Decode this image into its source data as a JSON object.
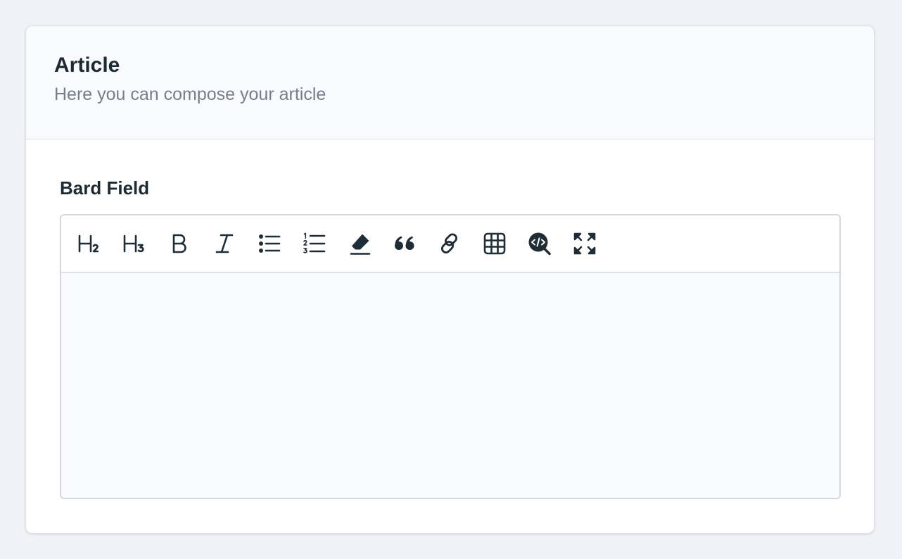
{
  "card": {
    "title": "Article",
    "subtitle": "Here you can compose your article"
  },
  "field": {
    "label": "Bard Field",
    "content": ""
  },
  "toolbar": {
    "buttons": [
      {
        "name": "heading-2",
        "icon": "h2-icon"
      },
      {
        "name": "heading-3",
        "icon": "h3-icon"
      },
      {
        "name": "bold",
        "icon": "bold-icon"
      },
      {
        "name": "italic",
        "icon": "italic-icon"
      },
      {
        "name": "bullet-list",
        "icon": "unordered-list-icon"
      },
      {
        "name": "ordered-list",
        "icon": "ordered-list-icon"
      },
      {
        "name": "clear-formatting",
        "icon": "eraser-icon"
      },
      {
        "name": "blockquote",
        "icon": "quote-icon"
      },
      {
        "name": "link",
        "icon": "link-icon"
      },
      {
        "name": "table",
        "icon": "table-icon"
      },
      {
        "name": "view-source",
        "icon": "code-search-icon"
      },
      {
        "name": "fullscreen",
        "icon": "expand-icon"
      }
    ]
  },
  "colors": {
    "page_background": "#eff2f6",
    "card_background": "#ffffff",
    "header_background": "#fafbfe",
    "text_primary": "#1c2a33",
    "text_muted": "#737f8c",
    "icon": "#1f2d36",
    "border": "#d4d8dd"
  }
}
